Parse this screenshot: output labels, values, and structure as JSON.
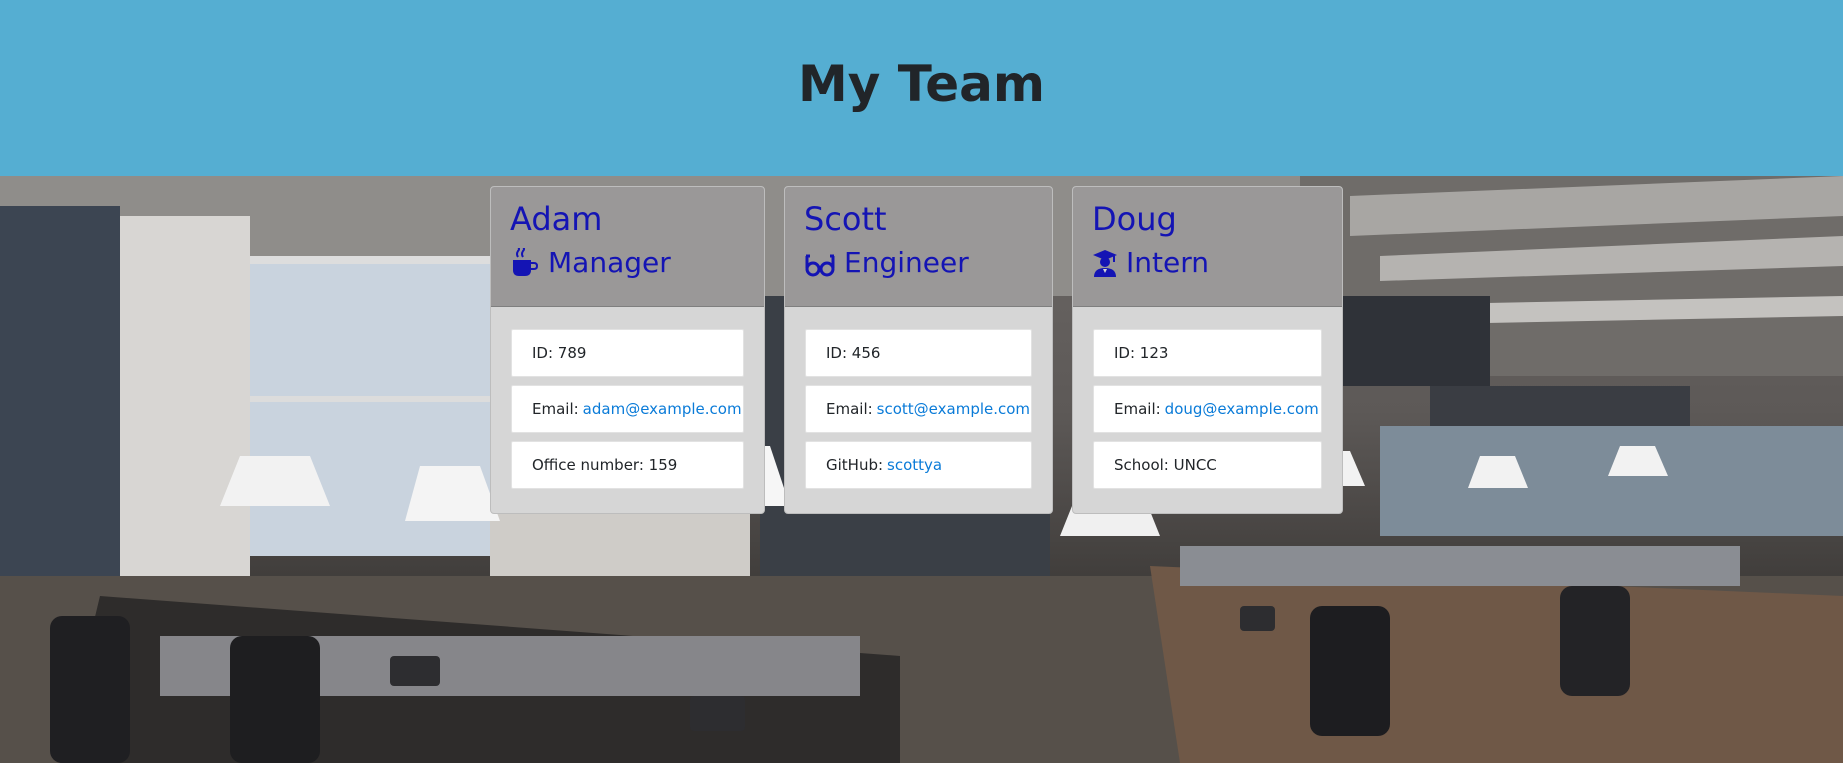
{
  "header": {
    "title": "My Team"
  },
  "background": {
    "image_description_icon": "office-photo"
  },
  "colors": {
    "header_bg": "#55aed2",
    "card_head_bg": "#9a9898",
    "card_body_bg": "#d6d6d6",
    "name_color": "#1414b4",
    "link_color": "#0a7bd8"
  },
  "team": [
    {
      "name": "Adam",
      "role": "Manager",
      "role_icon": "coffee-icon",
      "id_text": "ID: 789",
      "email_label": "Email:",
      "email": "adam@example.com",
      "extra_label": "Office number: 159",
      "extra_link": ""
    },
    {
      "name": "Scott",
      "role": "Engineer",
      "role_icon": "glasses-icon",
      "id_text": "ID: 456",
      "email_label": "Email:",
      "email": "scott@example.com",
      "extra_label": "GitHub:",
      "extra_link": "scottya"
    },
    {
      "name": "Doug",
      "role": "Intern",
      "role_icon": "graduate-icon",
      "id_text": "ID: 123",
      "email_label": "Email:",
      "email": "doug@example.com",
      "extra_label": "School: UNCC",
      "extra_link": ""
    }
  ]
}
